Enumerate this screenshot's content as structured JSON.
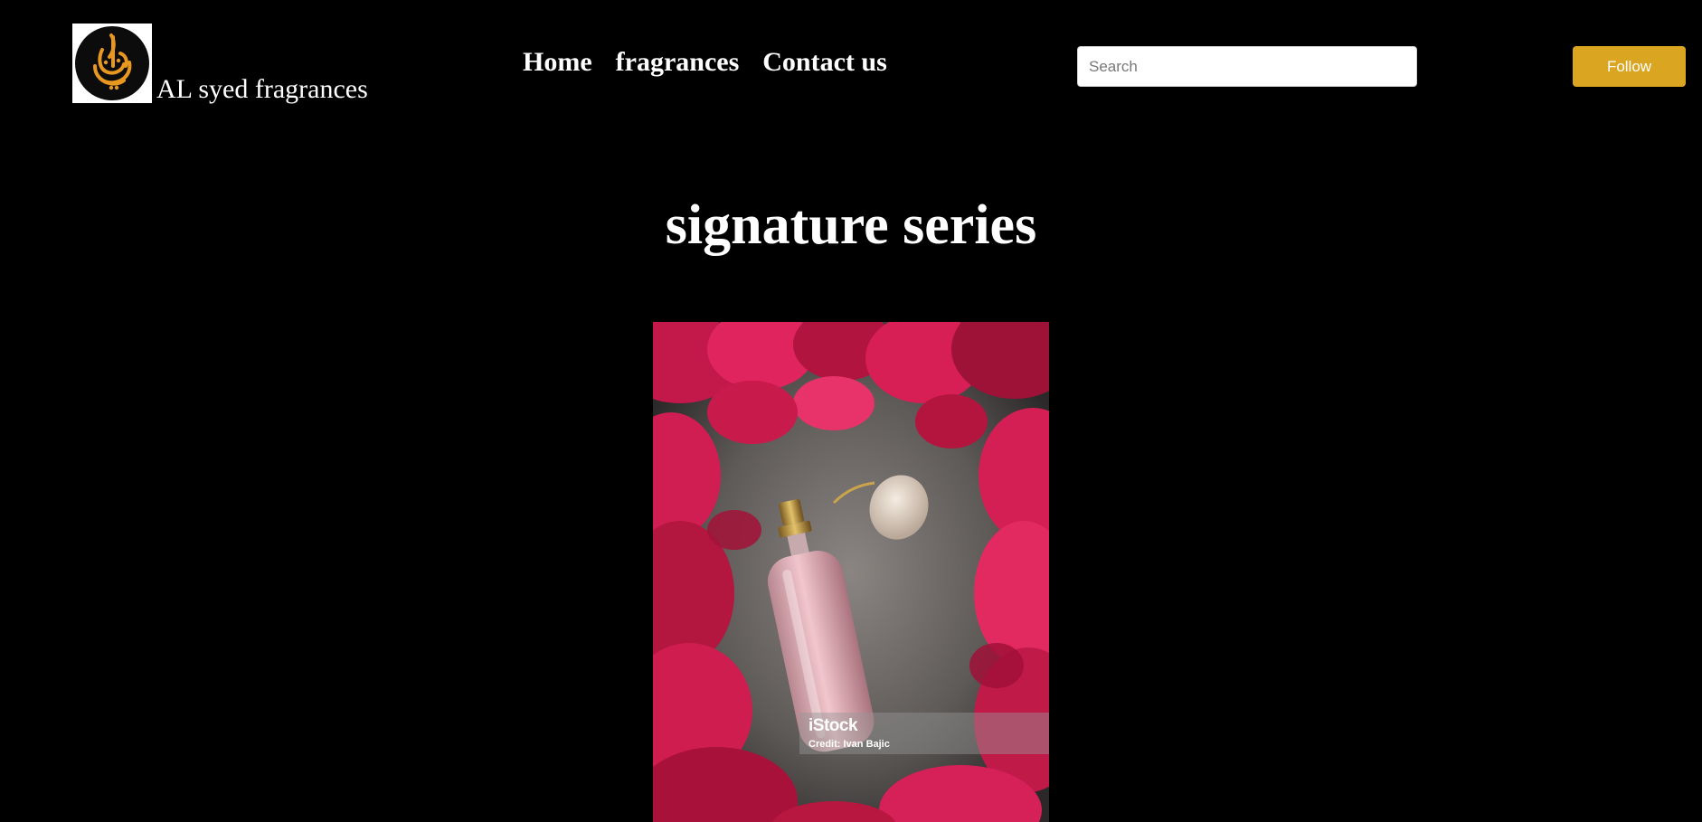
{
  "header": {
    "brand_name": "AL syed fragrances",
    "logo_text": "السيد"
  },
  "nav": {
    "items": [
      {
        "label": "Home"
      },
      {
        "label": "fragrances"
      },
      {
        "label": "Contact us"
      }
    ]
  },
  "search": {
    "placeholder": "Search",
    "value": ""
  },
  "follow_button": {
    "label": "Follow"
  },
  "main": {
    "section_title": "signature series",
    "image": {
      "watermark_brand": "iStock",
      "watermark_credit": "Credit: Ivan Bajic"
    }
  },
  "colors": {
    "background": "#000000",
    "text": "#ffffff",
    "accent": "#daa520",
    "logo_gold": "#e8971f"
  }
}
